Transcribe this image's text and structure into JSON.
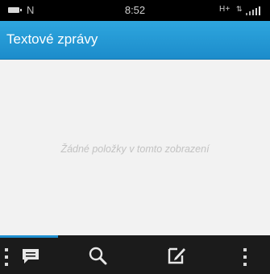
{
  "status_bar": {
    "notification_letter": "N",
    "time": "8:52",
    "network": "H+",
    "battery_icon": "battery-icon",
    "signal_icon": "signal-icon",
    "data_icon": "data-transfer-icon"
  },
  "header": {
    "title": "Textové zprávy",
    "accent_color": "#1f90d0"
  },
  "main": {
    "empty_message": "Žádné položky v tomto zobrazení"
  },
  "action_bar": {
    "items": [
      {
        "icon": "message-icon",
        "active": true
      },
      {
        "icon": "search-icon",
        "active": false
      },
      {
        "icon": "compose-icon",
        "active": false
      },
      {
        "icon": "overflow-menu-icon",
        "active": false
      }
    ]
  }
}
